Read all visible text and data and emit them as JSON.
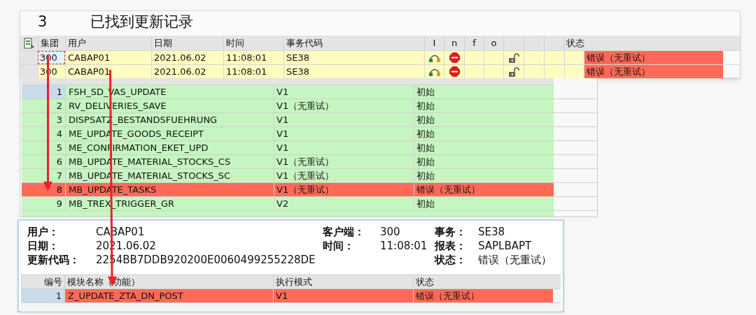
{
  "records_panel": {
    "count": "3",
    "title": "已找到更新记录",
    "columns": [
      "集团",
      "用户",
      "日期",
      "时间",
      "事务代码",
      "I",
      "n",
      "f",
      "o",
      "",
      "",
      "",
      "状态"
    ],
    "rows": [
      {
        "client": "300",
        "user": "CABAP01",
        "date": "2021.06.02",
        "time": "11:08:01",
        "tcode": "SE38",
        "status": "错误（无重试）",
        "kind": "error",
        "focused": true
      },
      {
        "client": "300",
        "user": "CABAP01",
        "date": "2021.06.02",
        "time": "11:08:01",
        "tcode": "SE38",
        "status": "错误（无重试）",
        "kind": "error",
        "focused": false
      }
    ]
  },
  "modules_panel": {
    "rows": [
      {
        "no": "1",
        "name": "FSH_SD_VAS_UPDATE",
        "mode": "V1",
        "status": "初始",
        "kind": "initial",
        "selected": true
      },
      {
        "no": "2",
        "name": "RV_DELIVERIES_SAVE",
        "mode": "V1（无重试）",
        "status": "初始",
        "kind": "initial",
        "selected": false
      },
      {
        "no": "3",
        "name": "DISPSATZ_BESTANDSFUEHRUNG",
        "mode": "V1",
        "status": "初始",
        "kind": "initial",
        "selected": false
      },
      {
        "no": "4",
        "name": "ME_UPDATE_GOODS_RECEIPT",
        "mode": "V1",
        "status": "初始",
        "kind": "initial",
        "selected": false
      },
      {
        "no": "5",
        "name": "ME_CONFIRMATION_EKET_UPD",
        "mode": "V1",
        "status": "初始",
        "kind": "initial",
        "selected": false
      },
      {
        "no": "6",
        "name": "MB_UPDATE_MATERIAL_STOCKS_CS",
        "mode": "V1（无重试）",
        "status": "初始",
        "kind": "initial",
        "selected": false
      },
      {
        "no": "7",
        "name": "MB_UPDATE_MATERIAL_STOCKS_SC",
        "mode": "V1（无重试）",
        "status": "初始",
        "kind": "initial",
        "selected": false
      },
      {
        "no": "8",
        "name": "MB_UPDATE_TASKS",
        "mode": "V1（无重试）",
        "status": "错误（无重试）",
        "kind": "error",
        "selected": false
      },
      {
        "no": "9",
        "name": "MB_TREX_TRIGGER_GR",
        "mode": "V2",
        "status": "初始",
        "kind": "initial",
        "selected": false
      }
    ]
  },
  "detail_panel": {
    "fields_left": [
      {
        "label": "用户：",
        "value": "CABAP01"
      },
      {
        "label": "日期：",
        "value": "2021.06.02"
      },
      {
        "label": "更新代码：",
        "value": "2254BB7DDB920200E0060499255228DE"
      }
    ],
    "fields_mid": [
      {
        "label": "客户端：",
        "value": "300"
      },
      {
        "label": "时间：",
        "value": "11:08:01"
      }
    ],
    "fields_right": [
      {
        "label": "事务：",
        "value": "SE38"
      },
      {
        "label": "报表：",
        "value": "SAPLBAPT"
      },
      {
        "label": "状态：",
        "value": "错误（无重试）"
      }
    ],
    "columns": [
      "编号",
      "模块名称（功能）",
      "执行模式",
      "状态"
    ],
    "rows": [
      {
        "no": "1",
        "name": "Z_UPDATE_ZTA_DN_POST",
        "mode": "V1",
        "status": "错误（无重试）",
        "kind": "error",
        "selected": true
      }
    ]
  }
}
